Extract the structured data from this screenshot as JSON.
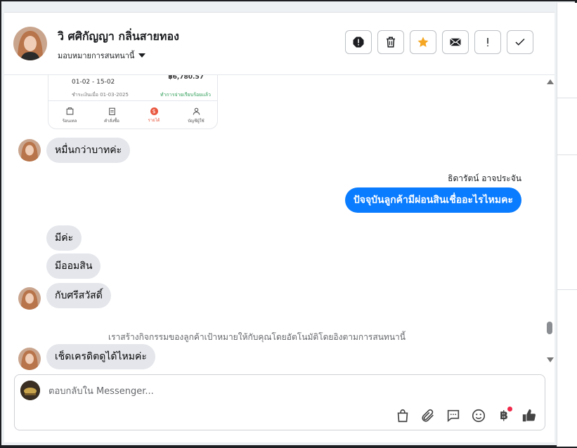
{
  "contact": {
    "name": "วิ ศศิกัญญา กลิ่นสายทอง",
    "assignment": "มอบหมายการสนทนานี้"
  },
  "header_actions": [
    {
      "name": "report-spam-icon"
    },
    {
      "name": "trash-icon"
    },
    {
      "name": "star-icon"
    },
    {
      "name": "mark-unread-icon"
    },
    {
      "name": "follow-up-icon"
    },
    {
      "name": "done-check-icon"
    }
  ],
  "shared_card": {
    "date_range": "01-02 - 15-02",
    "amount": "฿6,780.57",
    "paid_on": "ชำระเงินเมื่อ 01-03-2025",
    "status": "ทำการจ่ายเรียบร้อยแล้ว",
    "tabs": [
      "ร้อนเทล",
      "คำสั่งซื้อ",
      "รายได้",
      "บัญชีผู้ใช้"
    ]
  },
  "messages": [
    {
      "direction": "in",
      "text": "หมื่นกว่าบาทค่ะ"
    },
    {
      "direction": "out",
      "sender": "ธิดารัตน์ อาจประจัน",
      "text": "ปัจจุบันลูกค้ามีผ่อนสินเชื่ออะไรไหมคะ"
    },
    {
      "direction": "in",
      "text": "มีค่ะ"
    },
    {
      "direction": "in",
      "text": "มีออมสิน"
    },
    {
      "direction": "in",
      "text": "กับศรีสวัสดิ์"
    },
    {
      "direction": "in",
      "text": "เช็ดเครดิตดูได้ไหมค่ะ"
    }
  ],
  "system_note": "เราสร้างกิจกรรมของลูกค้าเป้าหมายให้กับคุณโดยอัตโนมัติโดยอิงตามการสนทนานี้",
  "composer": {
    "placeholder": "ตอบกลับใน Messenger...",
    "tools": [
      "shopping-bag-icon",
      "paperclip-icon",
      "chat-bubble-icon",
      "smiley-icon",
      "baht-icon",
      "thumbs-up-icon"
    ],
    "baht_symbol": "฿"
  },
  "colors": {
    "accent": "#0a7cff",
    "star": "#f5a623",
    "bubble_in": "#e4e6eb",
    "earnings_tab": "#e9573f"
  }
}
